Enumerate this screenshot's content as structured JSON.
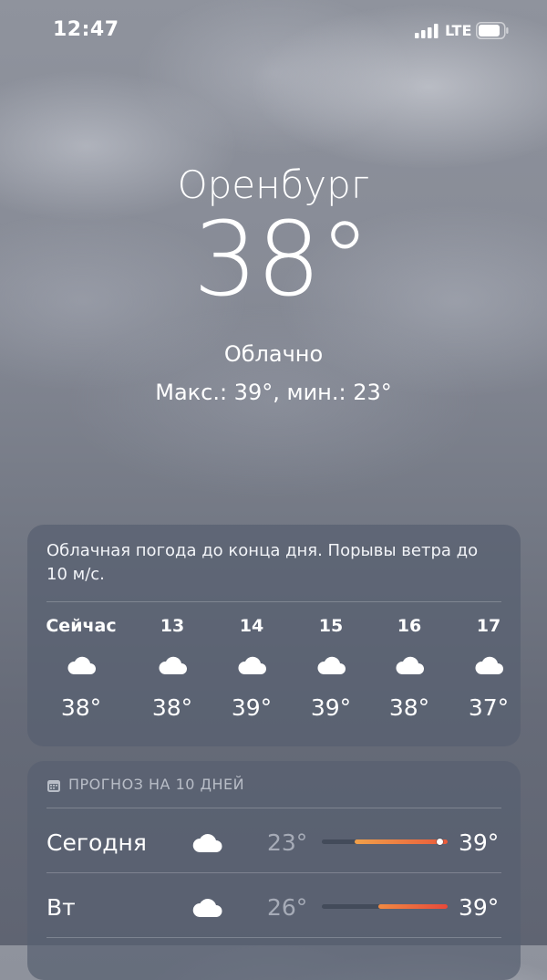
{
  "status_bar": {
    "time": "12:47",
    "network": "LTE",
    "signal_icon": "cellular-signal-icon",
    "battery_icon": "battery-icon"
  },
  "current": {
    "city": "Оренбург",
    "temperature": "38°",
    "condition": "Облачно",
    "high_low": "Макс.: 39°, мин.: 23°"
  },
  "hourly": {
    "summary": "Облачная погода до конца дня. Порывы ветра до 10 м/с.",
    "items": [
      {
        "label": "Сейчас",
        "icon": "cloud-icon",
        "temp": "38°"
      },
      {
        "label": "13",
        "icon": "cloud-icon",
        "temp": "38°"
      },
      {
        "label": "14",
        "icon": "cloud-icon",
        "temp": "39°"
      },
      {
        "label": "15",
        "icon": "cloud-icon",
        "temp": "39°"
      },
      {
        "label": "16",
        "icon": "cloud-icon",
        "temp": "38°"
      },
      {
        "label": "17",
        "icon": "cloud-icon",
        "temp": "37°"
      }
    ]
  },
  "daily": {
    "header": "ПРОГНОЗ НА 10 ДНЕЙ",
    "header_icon": "calendar-icon",
    "range_low": 23,
    "range_high": 39,
    "days": [
      {
        "name": "Сегодня",
        "icon": "cloud-icon",
        "low": "23°",
        "high": "39°",
        "low_value": 23,
        "high_value": 39,
        "current_value": 38,
        "bar_colors": [
          "#f0a04a",
          "#ea5a3a"
        ]
      },
      {
        "name": "Вт",
        "icon": "cloud-icon",
        "low": "26°",
        "high": "39°",
        "low_value": 26,
        "high_value": 39,
        "bar_colors": [
          "#f08a42",
          "#e8493a"
        ]
      }
    ]
  },
  "colors": {
    "card_bg": "#586070",
    "text": "#ffffff"
  }
}
